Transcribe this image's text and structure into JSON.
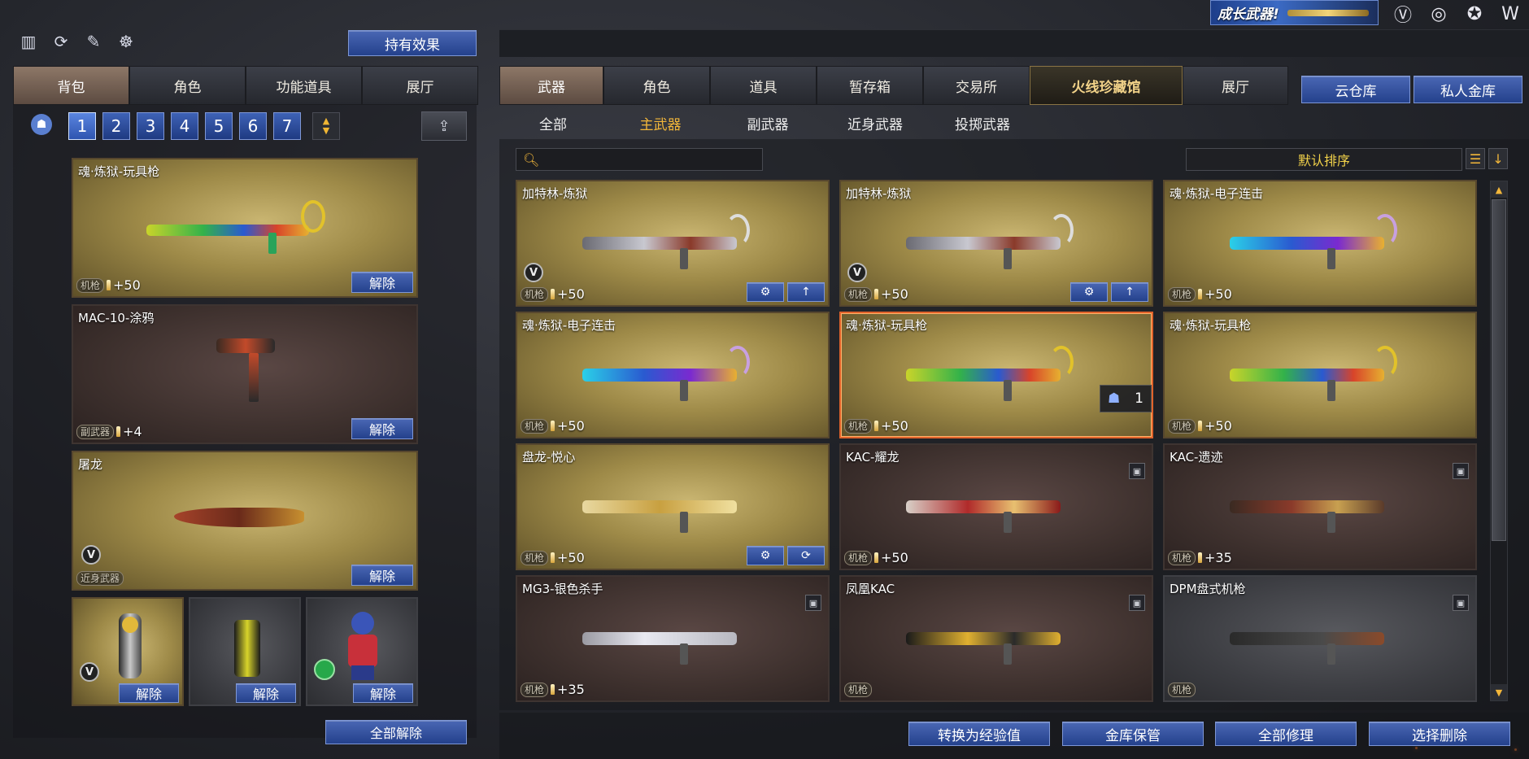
{
  "top_icons": [
    "ranking-icon",
    "refresh-icon",
    "character-icon",
    "mouse-icon"
  ],
  "effect_button": "持有效果",
  "promo": {
    "text": "成长武器!"
  },
  "top_right_icons": [
    "v-emblem-icon",
    "target-icon",
    "badge-icon",
    "w-emblem-icon"
  ],
  "left_tabs": [
    "背包",
    "角色",
    "功能道具",
    "展厅"
  ],
  "pages": [
    "1",
    "2",
    "3",
    "4",
    "5",
    "6",
    "7"
  ],
  "left_items": [
    {
      "name": "魂·炼狱-玩具枪",
      "tag": "机枪",
      "bonus": "+50",
      "button": "解除"
    },
    {
      "name": "MAC-10-涂鸦",
      "tag": "副武器",
      "bonus": "+4",
      "button": "解除"
    },
    {
      "name": "屠龙",
      "tag": "近身武器",
      "bonus": "",
      "button": "解除"
    }
  ],
  "left_small_items": [
    {
      "button": "解除"
    },
    {
      "button": "解除"
    },
    {
      "button": "解除"
    }
  ],
  "release_all": "全部解除",
  "right_tabs": [
    "武器",
    "角色",
    "道具",
    "暂存箱",
    "交易所",
    "火线珍藏馆",
    "展厅"
  ],
  "cloud_button": "云仓库",
  "vault_button": "私人金库",
  "sub_tabs": [
    "全部",
    "主武器",
    "副武器",
    "近身武器",
    "投掷武器"
  ],
  "search": {
    "value": "",
    "placeholder": ""
  },
  "sort_label": "默认排序",
  "grid": [
    {
      "name": "加特林-炼狱",
      "tag": "机枪",
      "bonus": "+50"
    },
    {
      "name": "加特林-炼狱",
      "tag": "机枪",
      "bonus": "+50"
    },
    {
      "name": "魂·炼狱-电子连击",
      "tag": "机枪",
      "bonus": "+50"
    },
    {
      "name": "魂·炼狱-电子连击",
      "tag": "机枪",
      "bonus": "+50"
    },
    {
      "name": "魂·炼狱-玩具枪",
      "tag": "机枪",
      "bonus": "+50",
      "count": "1"
    },
    {
      "name": "魂·炼狱-玩具枪",
      "tag": "机枪",
      "bonus": "+50"
    },
    {
      "name": "盘龙-悦心",
      "tag": "机枪",
      "bonus": "+50"
    },
    {
      "name": "KAC-耀龙",
      "tag": "机枪",
      "bonus": "+50"
    },
    {
      "name": "KAC-遗迹",
      "tag": "机枪",
      "bonus": "+35"
    },
    {
      "name": "MG3-银色杀手",
      "tag": "机枪",
      "bonus": "+35"
    },
    {
      "name": "凤凰KAC",
      "tag": "机枪",
      "bonus": ""
    },
    {
      "name": "DPM盘式机枪",
      "tag": "机枪",
      "bonus": ""
    }
  ],
  "bottom_buttons": [
    "转换为经验值",
    "金库保管",
    "全部修理",
    "选择删除"
  ]
}
